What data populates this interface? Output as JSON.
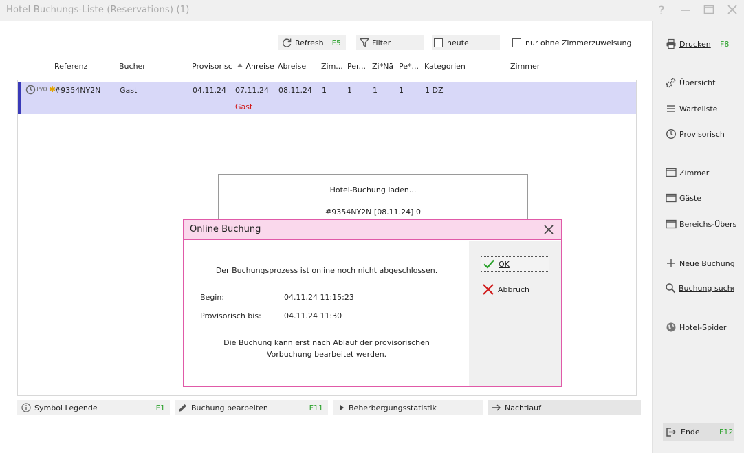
{
  "window": {
    "title": "Hotel Buchungs-Liste (Reservations) (1)",
    "controls": [
      "help-icon",
      "minimize-icon",
      "maximize-icon",
      "close-icon"
    ]
  },
  "toolbar": {
    "refresh_label": "Refresh",
    "refresh_key": "F5",
    "filter_label": "Filter",
    "heute_label": "heute",
    "zimmer_checkbox_label": "nur ohne Zimmerzuweisung"
  },
  "columns": {
    "referenz": "Referenz",
    "bucher": "Bucher",
    "provisorisch": "Provisorisc",
    "anreise": "Anreise",
    "abreise": "Abreise",
    "zim": "Zim...",
    "per": "Per...",
    "zina": "Zi*Nä",
    "pe": "Pe*...",
    "kategorien": "Kategorien",
    "zimmer": "Zimmer"
  },
  "row": {
    "symbols": "P/0",
    "referenz": "#9354NY2N",
    "bucher": "Gast",
    "provisorisch": "04.11.24",
    "anreise": "07.11.24",
    "abreise": "08.11.24",
    "zim": "1",
    "per": "1",
    "zina": "1",
    "pe": "1",
    "kategorien": "1 DZ",
    "sub_label": "Gast"
  },
  "loading": {
    "line1": "Hotel-Buchung laden...",
    "line2": "#9354NY2N [08.11.24] 0"
  },
  "dialog": {
    "title": "Online Buchung",
    "message": "Der Buchungsprozess ist online noch nicht abgeschlossen.",
    "begin_label": "Begin:",
    "begin_value": "04.11.24 11:15:23",
    "prov_label": "Provisorisch bis:",
    "prov_value": "04.11.24 11:30",
    "note_line1": "Die Buchung kann erst nach Ablauf der provisorischen",
    "note_line2": "Vorbuchung bearbeitet werden.",
    "ok_label": "OK",
    "cancel_label": "Abbruch"
  },
  "bottom": {
    "legend_label": "Symbol Legende",
    "legend_key": "F1",
    "edit_label": "Buchung bearbeiten",
    "edit_key": "F11",
    "stats_label": "Beherbergungsstatistik",
    "night_label": "Nachtlauf"
  },
  "sidebar": {
    "drucken": "Drucken",
    "drucken_key": "F8",
    "uebersicht": "Übersicht",
    "warteliste": "Warteliste",
    "provisorisch": "Provisorisch",
    "zimmer": "Zimmer",
    "gaeste": "Gäste",
    "bereichs": "Bereichs-Übers",
    "neue_buchung": "Neue Buchung",
    "buchung_suche": "Buchung suche",
    "spider": "Hotel-Spider",
    "ende": "Ende",
    "ende_key": "F12"
  },
  "colors": {
    "row_highlight": "#d8d8f8",
    "dialog_border": "#e05aa8",
    "dialog_title_bg": "#fad8ec",
    "shortcut_green": "#2aa12a",
    "alert_red": "#d01818"
  }
}
